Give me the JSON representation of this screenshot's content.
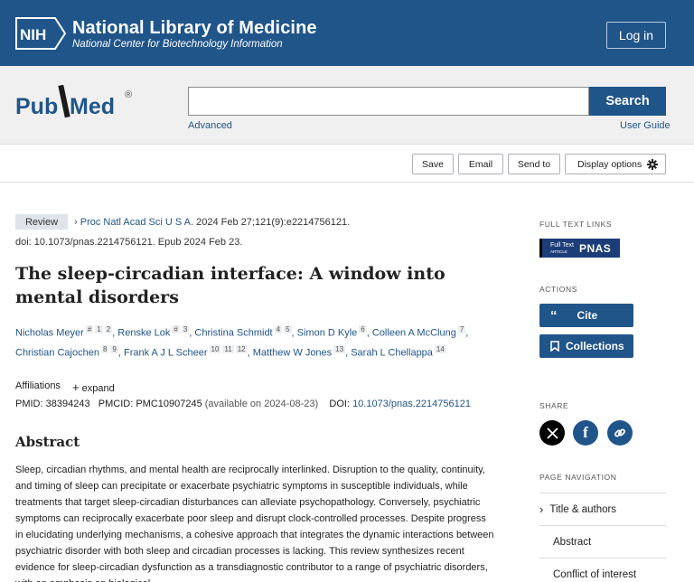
{
  "nih": {
    "logo_text": "NIH",
    "title": "National Library of Medicine",
    "subtitle": "National Center for Biotechnology Information",
    "login_label": "Log in"
  },
  "pubmed": {
    "logo_pub": "Pub",
    "logo_med": "Med",
    "logo_reg": "®",
    "search_value": "",
    "search_label": "Search",
    "advanced_label": "Advanced",
    "guide_label": "User Guide"
  },
  "actions": {
    "save": "Save",
    "email": "Email",
    "send_to": "Send to",
    "display_options": "Display options"
  },
  "article": {
    "badge": "Review",
    "journal": "Proc Natl Acad Sci U S A.",
    "citation": "2024 Feb 27;121(9):e2214756121.",
    "doi_line": "doi: 10.1073/pnas.2214756121. Epub 2024 Feb 23.",
    "title": "The sleep-circadian interface: A window into mental disorders",
    "authors": [
      {
        "name": "Nicholas Meyer",
        "sups": [
          "#",
          "1",
          "2"
        ]
      },
      {
        "name": "Renske Lok",
        "sups": [
          "#",
          "3"
        ]
      },
      {
        "name": "Christina Schmidt",
        "sups": [
          "4",
          "5"
        ]
      },
      {
        "name": "Simon D Kyle",
        "sups": [
          "6"
        ]
      },
      {
        "name": "Colleen A McClung",
        "sups": [
          "7"
        ]
      },
      {
        "name": "Christian Cajochen",
        "sups": [
          "8",
          "9"
        ]
      },
      {
        "name": "Frank A J L Scheer",
        "sups": [
          "10",
          "11",
          "12"
        ]
      },
      {
        "name": "Matthew W Jones",
        "sups": [
          "13"
        ]
      },
      {
        "name": "Sarah L Chellappa",
        "sups": [
          "14"
        ]
      }
    ],
    "affiliations_label": "Affiliations",
    "expand_label": "expand",
    "pmid_label": "PMID:",
    "pmid": "38394243",
    "pmcid_label": "PMCID:",
    "pmcid": "PMC10907245",
    "pmcid_note": "(available on 2024-08-23)",
    "doi_label": "DOI:",
    "doi": "10.1073/pnas.2214756121",
    "abstract_heading": "Abstract",
    "abstract_text": "Sleep, circadian rhythms, and mental health are reciprocally interlinked. Disruption to the quality, continuity, and timing of sleep can precipitate or exacerbate psychiatric symptoms in susceptible individuals, while treatments that target sleep-circadian disturbances can alleviate psychopathology. Conversely, psychiatric symptoms can reciprocally exacerbate poor sleep and disrupt clock-controlled processes. Despite progress in elucidating underlying mechanisms, a cohesive approach that integrates the dynamic interactions between psychiatric disorder with both sleep and circadian processes is lacking. This review synthesizes recent evidence for sleep-circadian dysfunction as a transdiagnostic contributor to a range of psychiatric disorders, with an emphasis on biological"
  },
  "sidebar": {
    "full_text_heading": "FULL TEXT LINKS",
    "full_text_badge_top": "Full Text",
    "full_text_badge_bottom": "ARTICLE",
    "full_text_badge_brand": "PNAS",
    "actions_heading": "ACTIONS",
    "cite_label": "Cite",
    "collections_label": "Collections",
    "share_heading": "SHARE",
    "page_nav_heading": "PAGE NAVIGATION",
    "nav_items": [
      "Title & authors",
      "Abstract",
      "Conflict of interest"
    ]
  },
  "colors": {
    "brand_blue": "#20558a",
    "facebook_blue": "#20558a",
    "x_black": "#000000"
  }
}
